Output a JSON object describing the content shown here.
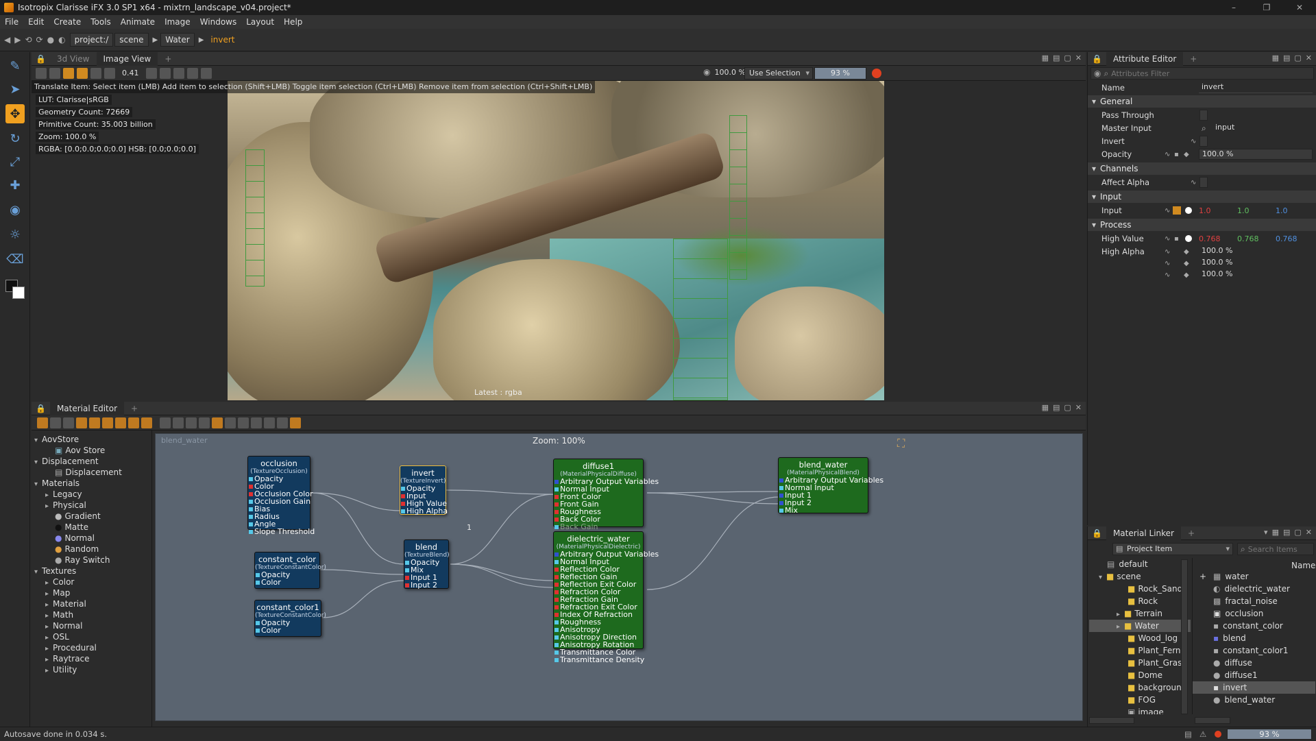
{
  "window": {
    "title": "Isotropix Clarisse iFX 3.0 SP1 x64  - mixtrn_landscape_v04.project*",
    "controls": [
      "–",
      "❐",
      "✕"
    ]
  },
  "menu": [
    "File",
    "Edit",
    "Create",
    "Tools",
    "Animate",
    "Image",
    "Windows",
    "Layout",
    "Help"
  ],
  "breadcrumb": [
    "project:/",
    "scene",
    "Water",
    "invert"
  ],
  "viewport": {
    "tabs": [
      "3d View",
      "Image View"
    ],
    "frame_value": "0.41",
    "zoom_pct": "100.0 %",
    "selection_mode": "Use Selection",
    "progress_label": "93 %",
    "status_hint": "Translate Item: Select item (LMB)  Add item to selection (Shift+LMB)  Toggle item selection (Ctrl+LMB)  Remove item from selection (Ctrl+Shift+LMB)",
    "hud": [
      "LUT: Clarisse|sRGB",
      "Geometry Count: 72669",
      "Primitive Count: 35.003 billion",
      "Zoom: 100.0 %",
      "RGBA: [0.0;0.0;0.0;0.0] HSB: [0.0;0.0;0.0]"
    ],
    "layer_label": "Latest : rgba"
  },
  "attribute_editor": {
    "tab": "Attribute Editor",
    "filter_placeholder": "Attributes Filter",
    "name_label": "Name",
    "name_value": "invert",
    "sections": {
      "general": "General",
      "channels": "Channels",
      "input": "Input",
      "process": "Process"
    },
    "rows": {
      "pass_through": "Pass Through",
      "master_input": "Master Input",
      "master_input_value": "input",
      "invert": "Invert",
      "opacity": "Opacity",
      "opacity_value": "100.0 %",
      "affect_alpha": "Affect Alpha",
      "input": "Input",
      "input_r": "1.0",
      "input_g": "1.0",
      "input_b": "1.0",
      "high_value": "High Value",
      "hv_r": "0.768",
      "hv_g": "0.768",
      "hv_b": "0.768",
      "high_alpha": "High Alpha",
      "ha_1": "100.0 %",
      "ha_2": "100.0 %",
      "ha_3": "100.0 %"
    }
  },
  "material_editor": {
    "tab": "Material Editor",
    "context_label": "blend_water",
    "zoom_label": "Zoom: 100%",
    "edge_label": "1",
    "tree": [
      {
        "label": "AovStore",
        "depth": 0,
        "arrow": "▾"
      },
      {
        "label": "Aov Store",
        "depth": 2,
        "arrow": ""
      },
      {
        "label": "Displacement",
        "depth": 0,
        "arrow": "▾"
      },
      {
        "label": "Displacement",
        "depth": 2,
        "arrow": ""
      },
      {
        "label": "Materials",
        "depth": 0,
        "arrow": "▾"
      },
      {
        "label": "Legacy",
        "depth": 1,
        "arrow": "▸"
      },
      {
        "label": "Physical",
        "depth": 1,
        "arrow": "▸"
      },
      {
        "label": "Gradient",
        "depth": 2,
        "arrow": ""
      },
      {
        "label": "Matte",
        "depth": 2,
        "arrow": ""
      },
      {
        "label": "Normal",
        "depth": 2,
        "arrow": ""
      },
      {
        "label": "Random",
        "depth": 2,
        "arrow": ""
      },
      {
        "label": "Ray Switch",
        "depth": 2,
        "arrow": ""
      },
      {
        "label": "Textures",
        "depth": 0,
        "arrow": "▾"
      },
      {
        "label": "Color",
        "depth": 1,
        "arrow": "▸"
      },
      {
        "label": "Map",
        "depth": 1,
        "arrow": "▸"
      },
      {
        "label": "Material",
        "depth": 1,
        "arrow": "▸"
      },
      {
        "label": "Math",
        "depth": 1,
        "arrow": "▸"
      },
      {
        "label": "Normal",
        "depth": 1,
        "arrow": "▸"
      },
      {
        "label": "OSL",
        "depth": 1,
        "arrow": "▸"
      },
      {
        "label": "Procedural",
        "depth": 1,
        "arrow": "▸"
      },
      {
        "label": "Raytrace",
        "depth": 1,
        "arrow": "▸"
      },
      {
        "label": "Utility",
        "depth": 1,
        "arrow": "▸"
      }
    ],
    "nodes": {
      "occlusion": {
        "title": "occlusion",
        "type": "(TextureOcclusion)",
        "ports": [
          "Opacity",
          "Color",
          "Occlusion Color",
          "Occlusion Gain",
          "Bias",
          "Radius",
          "Angle",
          "Slope Threshold"
        ]
      },
      "invert": {
        "title": "invert",
        "type": "(TextureInvert)",
        "ports": [
          "Opacity",
          "Input",
          "High Value",
          "High Alpha"
        ]
      },
      "constant_color": {
        "title": "constant_color",
        "type": "(TextureConstantColor)",
        "ports": [
          "Opacity",
          "Color"
        ]
      },
      "blend": {
        "title": "blend",
        "type": "(TextureBlend)",
        "ports": [
          "Opacity",
          "Mix",
          "Input 1",
          "Input 2"
        ]
      },
      "constant_color1": {
        "title": "constant_color1",
        "type": "(TextureConstantColor)",
        "ports": [
          "Opacity",
          "Color"
        ]
      },
      "diffuse1": {
        "title": "diffuse1",
        "type": "(MaterialPhysicalDiffuse)",
        "ports": [
          "Arbitrary Output Variables",
          "Normal Input",
          "Front Color",
          "Front Gain",
          "Roughness",
          "Back Color",
          "Back Gain"
        ]
      },
      "dielectric_water": {
        "title": "dielectric_water",
        "type": "(MaterialPhysicalDielectric)",
        "ports": [
          "Arbitrary Output Variables",
          "Normal Input",
          "Reflection Color",
          "Reflection Gain",
          "Reflection Exit Color",
          "Refraction Color",
          "Refraction Gain",
          "Refraction Exit Color",
          "Index Of Refraction",
          "Roughness",
          "Anisotropy",
          "Anisotropy Direction",
          "Anisotropy Rotation",
          "Transmittance Color",
          "Transmittance Density"
        ]
      },
      "blend_water": {
        "title": "blend_water",
        "type": "(MaterialPhysicalBlend)",
        "ports": [
          "Arbitrary Output Variables",
          "Normal Input",
          "Input 1",
          "Input 2",
          "Mix"
        ]
      }
    }
  },
  "material_linker": {
    "tab": "Material Linker",
    "dropdown": "Project Item",
    "search_placeholder": "Search Items",
    "column_name": "Name",
    "left_tree": [
      {
        "label": "default",
        "depth": 0,
        "arrow": ""
      },
      {
        "label": "scene",
        "depth": 0,
        "arrow": "▾"
      },
      {
        "label": "Rock_Sand",
        "depth": 1,
        "arrow": ""
      },
      {
        "label": "Rock",
        "depth": 1,
        "arrow": ""
      },
      {
        "label": "Terrain",
        "depth": 1,
        "arrow": "▸"
      },
      {
        "label": "Water",
        "depth": 1,
        "arrow": "▸"
      },
      {
        "label": "Wood_log",
        "depth": 1,
        "arrow": ""
      },
      {
        "label": "Plant_Ferns",
        "depth": 1,
        "arrow": ""
      },
      {
        "label": "Plant_Grass",
        "depth": 1,
        "arrow": ""
      },
      {
        "label": "Dome",
        "depth": 1,
        "arrow": ""
      },
      {
        "label": "background",
        "depth": 1,
        "arrow": ""
      },
      {
        "label": "FOG",
        "depth": 1,
        "arrow": ""
      },
      {
        "label": "image",
        "depth": 1,
        "arrow": ""
      }
    ],
    "right_list": [
      "water",
      "dielectric_water",
      "fractal_noise",
      "occlusion",
      "constant_color",
      "blend",
      "constant_color1",
      "diffuse",
      "diffuse1",
      "invert",
      "blend_water"
    ],
    "selected": "invert"
  },
  "status": {
    "message": "Autosave done in 0.034 s.",
    "progress": "93 %"
  },
  "colors": {
    "accent": "#f0a020",
    "node_blue": "#123a5e",
    "node_green": "#1e6a1e",
    "port_red": "#e03030",
    "port_cyan": "#56c8e8",
    "value_red": "#e04040",
    "value_green": "#60c060",
    "value_blue": "#5090e0"
  }
}
